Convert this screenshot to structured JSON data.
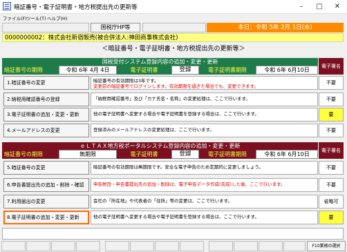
{
  "window": {
    "title": "暗証番号・電子証明書・地方税提出先の更新等"
  },
  "menu": [
    "ファイル(F)",
    "ツール(T)",
    "ヘルプ(H)"
  ],
  "toolbar": {
    "hp_button": "国税庁HP等",
    "date": "本日：令和 5年 2月 1日(水)"
  },
  "company": "0000000002：株式会社新宿販売(被合併法人:神田商事株式会社)",
  "page_title": "＜暗証番号・電子証明書・地方税提出先の更新等＞",
  "sign_header": "電子署名",
  "section1": {
    "header": "国税受付システム登録内容の追加・変更・更新",
    "pin_label": "暗証番号の期限",
    "pin_date": "令和 6年 4月 4日",
    "cert_label": "電子証明書",
    "cert_status": "登録",
    "cert_exp_label": "電子証明書期限",
    "cert_exp_date": "令和 6年 6月10日",
    "rows": [
      {
        "button": "1.暗証番号の変更",
        "desc1": "暗証番号の有効期限は3年です。",
        "desc2": "変更前の暗証番号でログインします。有効期限を過ぎた場合でも、変更できます。",
        "status": "不要"
      },
      {
        "button": "2.納税用確認番号の登録",
        "desc1": "「納税用確認番号」及び「カナ氏名・名称」の変更処理は、ここで行います。",
        "status": "不要"
      },
      {
        "button": "3.電子証明書の追加・変更・更新",
        "desc1": "他の電子証明書へ変更する場合や電子証明書を登録する場合は、ここで行います。",
        "status": "要"
      },
      {
        "button": "4.メールアドレスの変更",
        "desc1": "登録済みのメールアドレスの変更処理は、ここで行います。",
        "status": "不要"
      }
    ]
  },
  "section2": {
    "header": "ｅＬＴＡＸ地方税ポータルシステム登録内容の追加・変更・更新",
    "pin_label": "暗証番号の期限",
    "pin_value": "無期限",
    "cert_label": "電子証明書",
    "cert_status": "登録",
    "cert_exp_label": "電子証明書期限",
    "cert_exp_date": "令和 6年 6月10日",
    "rows": [
      {
        "button": "5.暗証番号の変更",
        "desc1": "暗証番号の有効期限は無期限です。安全な電子申告のため定期的に変更しましょう。",
        "status": "不要"
      },
      {
        "button": "6.申告書提出先の追加・削除・確認",
        "desc1": "申告税目・申告書提出先の追加・削除は、電子申告データ作成(完成)した後、ここで行います。",
        "status": "不要"
      },
      {
        "button": "7.利用届出の変更",
        "desc1": "会社の「所在地」や代表者の「住所」等の変更は、ここで行います。",
        "status": "省略可"
      },
      {
        "button": "8.電子証明書の追加・変更・更新",
        "desc1": "他の電子証明書へ変更する場合や電子証明書を登録する場合は、ここで行います。",
        "status": "要"
      }
    ]
  },
  "fkeys": {
    "f10": "F10業務の選択"
  }
}
